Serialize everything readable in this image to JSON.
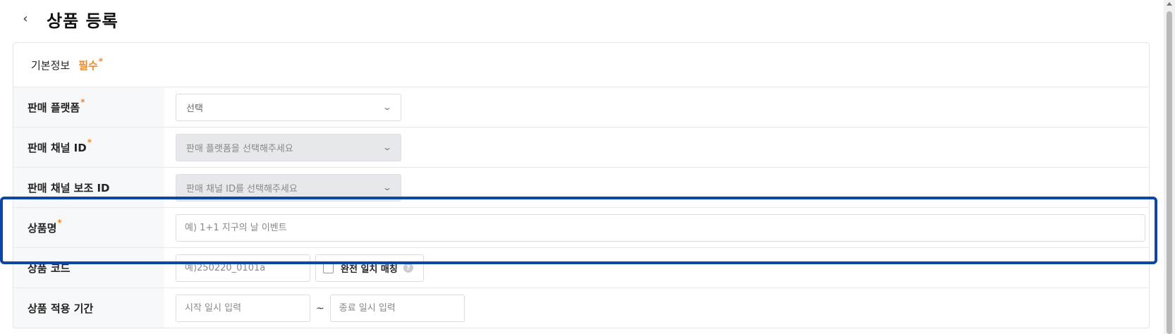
{
  "header": {
    "back_icon": "chevron-left-icon",
    "back_glyph": "‹",
    "title": "상품 등록"
  },
  "section": {
    "title": "기본정보",
    "required_label": "필수",
    "required_mark": "*"
  },
  "fields": {
    "platform": {
      "label": "판매 플랫폼",
      "required": true,
      "value": "선택"
    },
    "channel_id": {
      "label": "판매 채널 ID",
      "required": true,
      "value": "판매 플랫폼을 선택해주세요",
      "disabled": true
    },
    "sub_channel_id": {
      "label": "판매 채널 보조 ID",
      "required": false,
      "value": "판매 채널 ID를 선택해주세요",
      "disabled": true
    },
    "product_name": {
      "label": "상품명",
      "required": true,
      "placeholder": "예) 1+1 지구의 날 이벤트"
    },
    "product_code": {
      "label": "상품 코드",
      "placeholder": "예)250220_0101a",
      "checkbox_label": "완전 일치 매칭",
      "info_icon": "info-icon",
      "info_glyph": "?"
    },
    "period": {
      "label": "상품 적용 기간",
      "start_placeholder": "시작 일시 입력",
      "separator": "~",
      "end_placeholder": "종료 일시 입력"
    }
  },
  "icons": {
    "chevron_down": "⌄"
  },
  "colors": {
    "accent_required": "#f0892c",
    "highlight": "#0c47a8",
    "label_bg": "#f7f8fa",
    "disabled_bg": "#e6e8ec"
  }
}
